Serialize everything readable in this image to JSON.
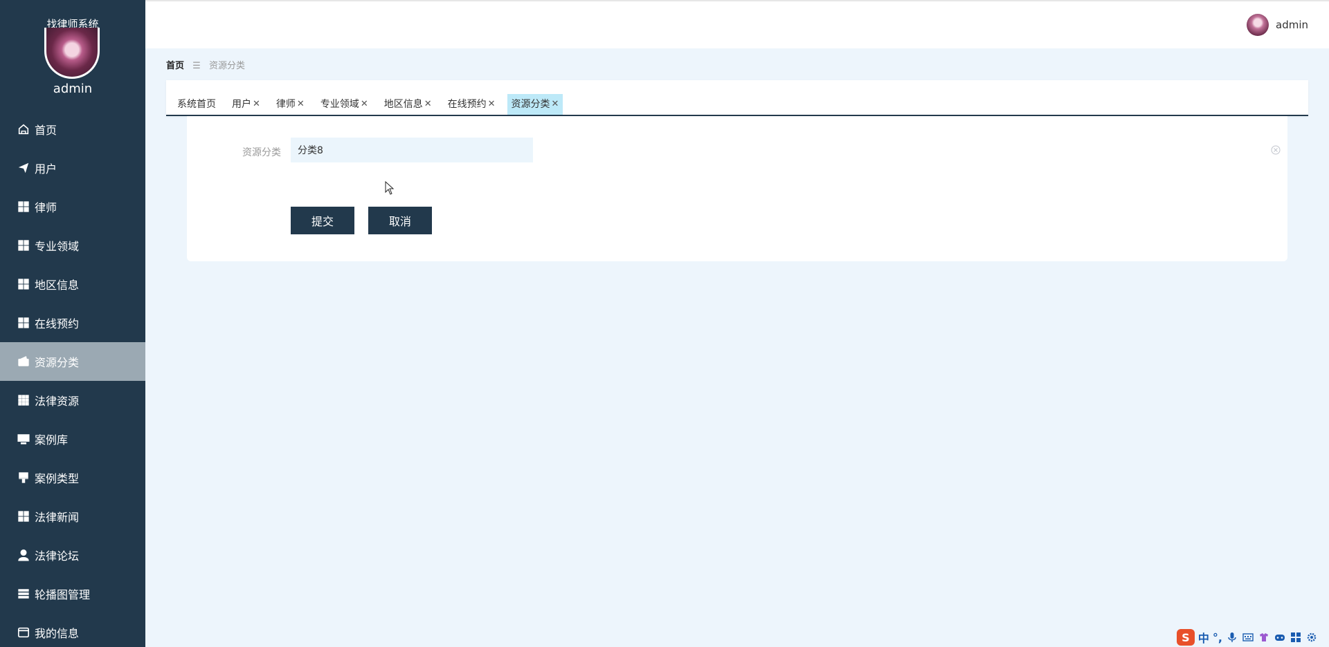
{
  "app": {
    "title": "找律师系统",
    "user": "admin"
  },
  "sidebar": {
    "items": [
      {
        "label": "首页",
        "icon": "home-icon"
      },
      {
        "label": "用户",
        "icon": "paper-plane-icon"
      },
      {
        "label": "律师",
        "icon": "grid-icon"
      },
      {
        "label": "专业领域",
        "icon": "grid-icon"
      },
      {
        "label": "地区信息",
        "icon": "grid-icon"
      },
      {
        "label": "在线预约",
        "icon": "grid-icon"
      },
      {
        "label": "资源分类",
        "icon": "wallet-icon",
        "active": true
      },
      {
        "label": "法律资源",
        "icon": "grid-9-icon"
      },
      {
        "label": "案例库",
        "icon": "monitor-icon"
      },
      {
        "label": "案例类型",
        "icon": "brush-icon"
      },
      {
        "label": "法律新闻",
        "icon": "grid-icon"
      },
      {
        "label": "法律论坛",
        "icon": "user-icon"
      },
      {
        "label": "轮播图管理",
        "icon": "list-icon"
      },
      {
        "label": "我的信息",
        "icon": "card-icon"
      }
    ]
  },
  "header": {
    "user": "admin"
  },
  "breadcrumb": {
    "home": "首页",
    "separator": "☰",
    "current": "资源分类"
  },
  "tabs": [
    {
      "label": "系统首页",
      "closable": false
    },
    {
      "label": "用户",
      "closable": true
    },
    {
      "label": "律师",
      "closable": true
    },
    {
      "label": "专业领域",
      "closable": true
    },
    {
      "label": "地区信息",
      "closable": true
    },
    {
      "label": "在线预约",
      "closable": true
    },
    {
      "label": "资源分类",
      "closable": true,
      "active": true
    }
  ],
  "form": {
    "label": "资源分类",
    "value": "分类8",
    "submit": "提交",
    "cancel": "取消"
  },
  "ime": {
    "brand": "S",
    "mode": "中",
    "punct": "°,"
  },
  "colors": {
    "sidebar": "#22394c",
    "active_menu": "#9ba9b3",
    "active_tab": "#bde9f8",
    "page_bg": "#edf5fc"
  }
}
